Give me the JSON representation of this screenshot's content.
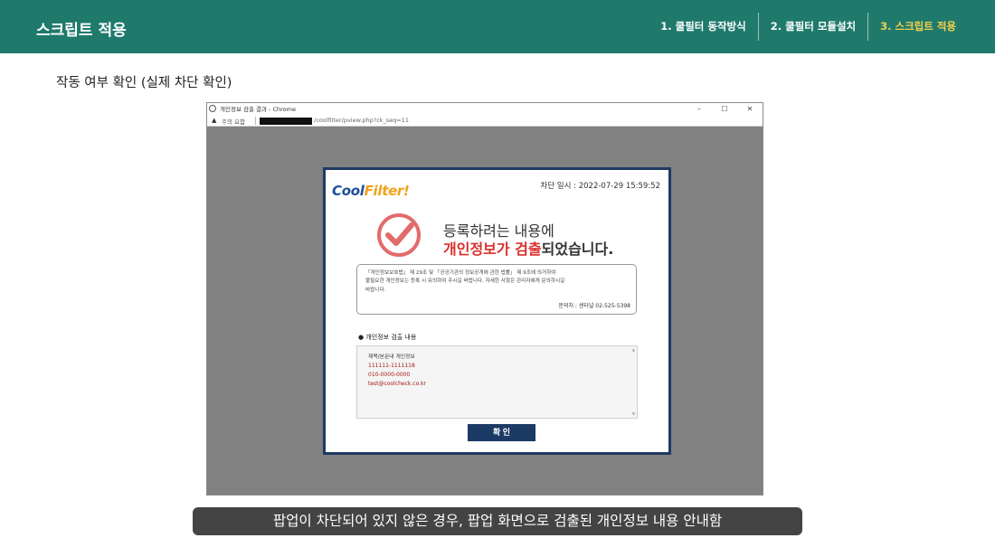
{
  "header": {
    "title": "스크립트 적용",
    "steps": [
      {
        "label": "1. 쿨필터 동작방식"
      },
      {
        "label": "2. 쿨필터 모듈설치"
      },
      {
        "label": "3. 스크립트 적용"
      }
    ]
  },
  "section_label": "작동 여부 확인 (실제 차단 확인)",
  "window": {
    "title": "개인정보 검출 결과 - Chrome",
    "controls": {
      "minimize": "–",
      "maximize": "☐",
      "close": "✕"
    },
    "address": {
      "warning_icon": "warning-triangle-icon",
      "warning_text": "주의 요함",
      "url": "/coolfilter/pview.php?ck_seq=11"
    }
  },
  "popup": {
    "logo": {
      "main": "Cool",
      "accent": "Filter!"
    },
    "block_time": "차단 일시 : 2022-07-29 15:59:52",
    "message_line1": "등록하려는 내용에",
    "message_line2_highlight": "개인정보가 검출",
    "message_line2_rest": "되었습니다.",
    "notice_lines": [
      "「개인정보보호법」 제 29조 및 「공공기관의 정보공개에 관한 법률」 제 9조에 의거하여",
      "불필요한 개인정보는 등록 시 유의하여 주시길 바랍니다. 자세한 사항은 관리자에게 문의하시길",
      "바랍니다."
    ],
    "contact": "문의처 : 센터널 02-525-5398",
    "detection_title": "● 개인정보 검출 내용",
    "detection": {
      "heading": "제목/본문내 개인정보",
      "items": [
        "111111-1111118",
        "010-0000-0000",
        "test@coolcheck.co.kr"
      ]
    },
    "confirm_label": "확 인"
  },
  "caption": "팝업이 차단되어 있지 않은 경우, 팝업 화면으로 검출된 개인정보 내용 안내함",
  "colors": {
    "header_bg": "#1f7a6c",
    "active_step": "#f5cf4c",
    "popup_border": "#1f3a64",
    "highlight_red": "#d9302c",
    "check_red": "#e26b6b"
  }
}
